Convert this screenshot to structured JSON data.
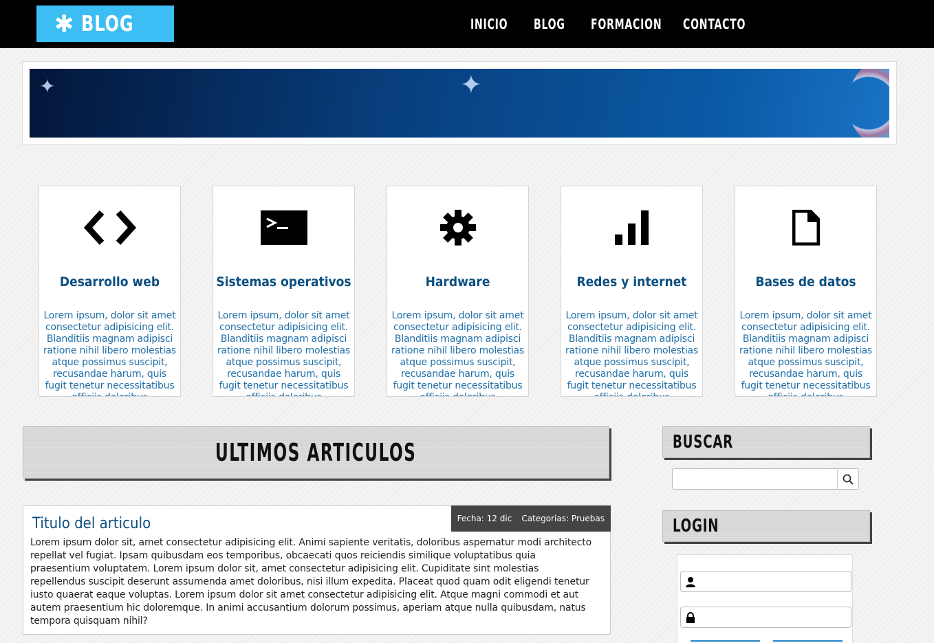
{
  "header": {
    "logo_text": "BLOG",
    "logo_icon": "gear-icon",
    "nav": [
      "INICIO",
      "BLOG",
      "FORMACION",
      "CONTACTO"
    ]
  },
  "categories": [
    {
      "title": "Desarrollo web",
      "icon": "code-icon",
      "text": "Lorem ipsum, dolor sit amet consectetur adipisicing elit. Blanditiis magnam adipisci ratione nihil libero molestias atque possimus suscipit, recusandae harum, quis fugit tenetur necessitatibus officiis doloribus"
    },
    {
      "title": "Sistemas operativos",
      "icon": "terminal-icon",
      "text": "Lorem ipsum, dolor sit amet consectetur adipisicing elit. Blanditiis magnam adipisci ratione nihil libero molestias atque possimus suscipit, recusandae harum, quis fugit tenetur necessitatibus officiis doloribus"
    },
    {
      "title": "Hardware",
      "icon": "gear-icon",
      "text": "Lorem ipsum, dolor sit amet consectetur adipisicing elit. Blanditiis magnam adipisci ratione nihil libero molestias atque possimus suscipit, recusandae harum, quis fugit tenetur necessitatibus officiis doloribus"
    },
    {
      "title": "Redes y internet",
      "icon": "signal-bars-icon",
      "text": "Lorem ipsum, dolor sit amet consectetur adipisicing elit. Blanditiis magnam adipisci ratione nihil libero molestias atque possimus suscipit, recusandae harum, quis fugit tenetur necessitatibus officiis doloribus"
    },
    {
      "title": "Bases de datos",
      "icon": "file-icon",
      "text": "Lorem ipsum, dolor sit amet consectetur adipisicing elit. Blanditiis magnam adipisci ratione nihil libero molestias atque possimus suscipit, recusandae harum, quis fugit tenetur necessitatibus officiis doloribus"
    }
  ],
  "articles_section": {
    "title": "ULTIMOS ARTICULOS"
  },
  "article": {
    "title": "Titulo del articulo",
    "date_label": "Fecha: 12 dic",
    "category_label": "Categorias: Pruebas",
    "body": "Lorem ipsum dolor sit, amet consectetur adipisicing elit. Animi sapiente veritatis, doloribus aspernatur modi architecto repellat vel fugiat. Ipsam quibusdam eos temporibus, obcaecati quos reiciendis similique voluptatibus quia praesentium voluptatem. Lorem ipsum dolor sit, amet consectetur adipisicing elit. Cupiditate sint molestias repellendus suscipit deserunt assumenda amet doloribus, nisi illum expedita. Placeat quod quam odit eligendi tenetur iusto quaerat eaque voluptas. Lorem ipsum dolor sit amet consectetur adipisicing elit. Atque magni commodi et aut autem praesentium hic doloremque. In animi accusantium dolorum possimus, aperiam atque nulla quibusdam, natus tempora quisquam nihil?"
  },
  "sidebar": {
    "search_title": "BUSCAR",
    "search_value": "",
    "search_icon": "search-icon",
    "login_title": "LOGIN",
    "username_value": "",
    "password_value": "",
    "user_icon": "user-icon",
    "lock_icon": "lock-icon"
  },
  "colors": {
    "logo_bg": "#3cbef5",
    "topbar_bg": "#000000",
    "title_blue": "#0b4f80",
    "text_blue": "#1f6fa8",
    "meta_bg": "#444444"
  }
}
